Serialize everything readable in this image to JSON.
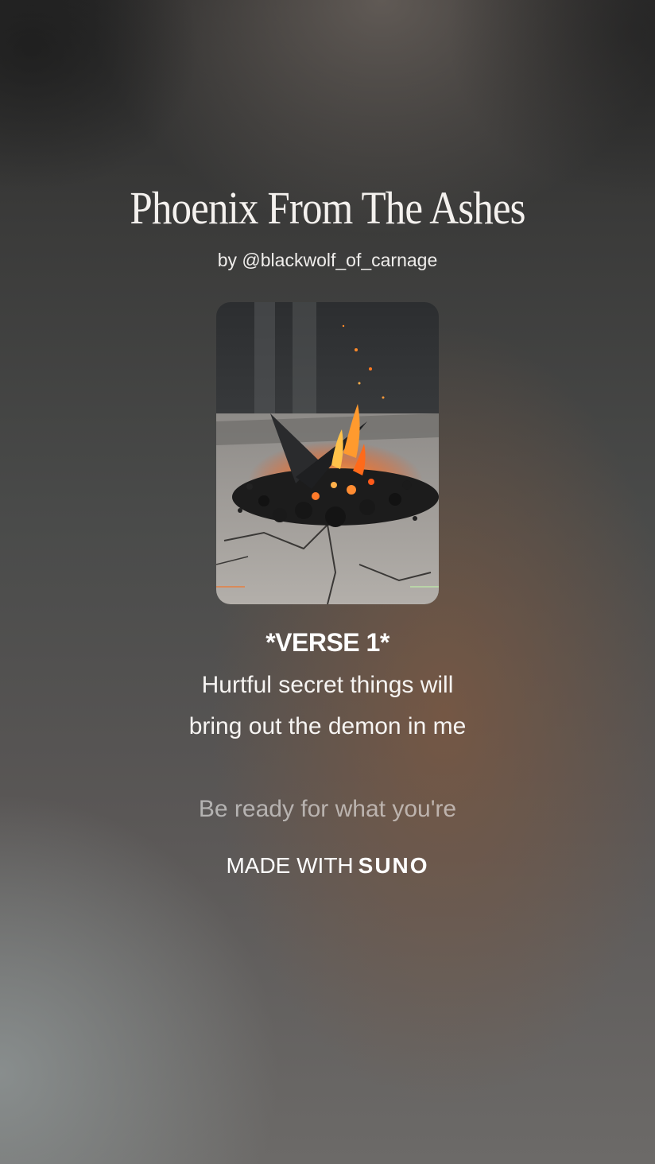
{
  "song": {
    "title": "Phoenix From The Ashes",
    "artist_line": "by @blackwolf_of_carnage"
  },
  "cover_art": {
    "icon": "campfire-ember-artwork"
  },
  "lyrics": {
    "section_label": "*VERSE 1*",
    "current_lines": [
      "Hurtful secret things will",
      "bring out the demon in me"
    ],
    "next_line": "Be ready for what you're"
  },
  "footer": {
    "made_with": "MADE WITH",
    "brand": "SUNO"
  },
  "colors": {
    "text": "#ffffff",
    "dimmed_text": "#8f8a86",
    "accent_warm": "#7a5842"
  }
}
